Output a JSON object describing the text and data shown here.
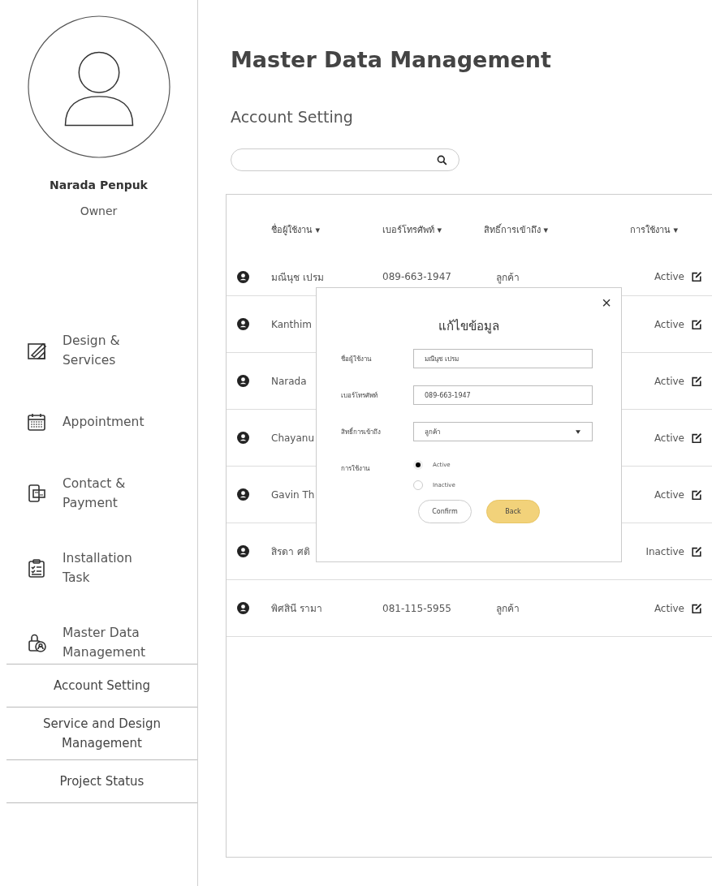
{
  "sidebar": {
    "profile": {
      "name": "Narada Penpuk",
      "role": "Owner"
    },
    "menu": [
      {
        "label": "Design &\nServices"
      },
      {
        "label": "Appointment"
      },
      {
        "label": "Contact &\nPayment"
      },
      {
        "label": "Installation\nTask"
      },
      {
        "label": "Master Data\nManagement"
      }
    ],
    "submenu": [
      {
        "label": "Account Setting"
      },
      {
        "label": "Service and Design\nManagement"
      },
      {
        "label": "Project Status"
      }
    ]
  },
  "page": {
    "title": "Master Data Management",
    "subtitle": "Account Setting"
  },
  "table": {
    "columns": [
      "ชื่อผู้ใช้งาน ▾",
      "เบอร์โทรศัพท์ ▾",
      "สิทธิ์การเข้าถึง ▾",
      "การใช้งาน ▾"
    ],
    "rows": [
      {
        "name": "มณีนุช เปรม",
        "phone": "089-663-1947",
        "access": "ลูกค้า",
        "status": "Active"
      },
      {
        "name": "Kanthim",
        "status": "Active"
      },
      {
        "name": "Narada",
        "status": "Active"
      },
      {
        "name": "Chayanu",
        "status": "Active"
      },
      {
        "name": "Gavin Th",
        "status": "Active"
      },
      {
        "name": "สิรดา ศติ",
        "status": "Inactive"
      },
      {
        "name": "พิศสินี รามา",
        "phone": "081-115-5955",
        "access": "ลูกค้า",
        "status": "Active"
      }
    ]
  },
  "modal": {
    "title": "แก้ไขข้อมูล",
    "close": "×",
    "fields": [
      {
        "kind": "text",
        "label": "ชื่อผู้ใช้งาน",
        "value": "มณีนุช เปรม"
      },
      {
        "kind": "text",
        "label": "เบอร์โทรศัพท์",
        "value": "089-663-1947"
      },
      {
        "kind": "select",
        "label": "สิทธิ์การเข้าถึง",
        "value": "ลูกค้า"
      }
    ],
    "status": {
      "label": "การใช้งาน",
      "options": [
        {
          "label": "Active",
          "selected": true
        },
        {
          "label": "Inactive",
          "selected": false
        }
      ]
    },
    "buttons": [
      {
        "kind": "outline",
        "label": "Confirm"
      },
      {
        "kind": "primary",
        "label": "Back"
      }
    ]
  }
}
